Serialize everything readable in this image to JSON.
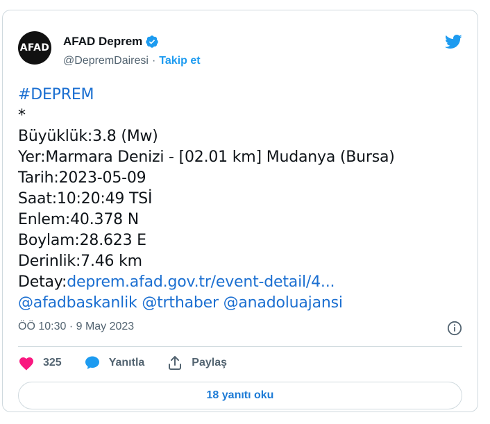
{
  "author": {
    "avatar_text": "AFAD",
    "name": "AFAD Deprem",
    "handle": "@DepremDairesi",
    "separator": "·",
    "follow_label": "Takip et"
  },
  "tweet": {
    "hashtag": "#DEPREM",
    "star": "*",
    "lines": [
      "Büyüklük:3.8 (Mw)",
      "Yer:Marmara Denizi - [02.01 km] Mudanya (Bursa)",
      "Tarih:2023-05-09",
      "Saat:10:20:49 TSİ",
      "Enlem:40.378 N",
      "Boylam:28.623 E",
      "Derinlik:7.46 km"
    ],
    "detail_prefix": "Detay:",
    "detail_link": "deprem.afad.gov.tr/event-detail/4...",
    "mentions": [
      "@afadbaskanlik",
      "@trthaber",
      "@anadoluajansi"
    ],
    "timestamp": "ÖÖ 10:30 · 9 May 2023"
  },
  "actions": {
    "like_count": "325",
    "reply_label": "Yanıtla",
    "share_label": "Paylaş"
  },
  "replies_button": "18 yanıtı oku",
  "colors": {
    "accent": "#1d9bf0",
    "link": "#1b6fd1",
    "heart": "#f91880",
    "muted": "#536471"
  },
  "icons": [
    "twitter-bird-icon",
    "verified-badge-icon",
    "info-icon",
    "heart-icon",
    "reply-bubble-icon",
    "share-icon"
  ]
}
